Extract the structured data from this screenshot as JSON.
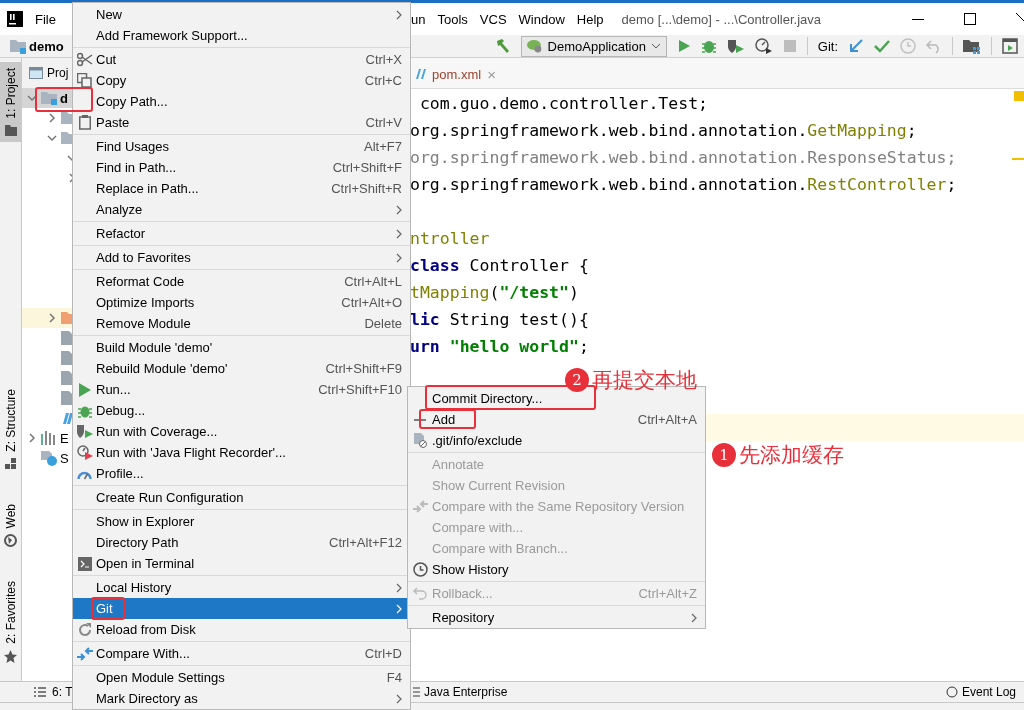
{
  "menu_bar": {
    "left_items": [
      "File"
    ],
    "right_items": [
      "un",
      "Tools",
      "VCS",
      "Window",
      "Help"
    ],
    "window_title": "demo [...\\demo] - ...\\Controller.java"
  },
  "nav_bar": {
    "project": "demo",
    "run_config": "DemoApplication",
    "git_label": "Git:"
  },
  "left_tool_tabs": [
    {
      "label": "1: Project",
      "selected": true
    },
    {
      "label": "Z: Structure",
      "selected": false
    },
    {
      "label": "Web",
      "selected": false
    },
    {
      "label": "2: Favorites",
      "selected": false
    }
  ],
  "project_panel": {
    "title": "Proj",
    "tree": [
      {
        "label": "d",
        "kind": "module",
        "selected": true,
        "expanded": true,
        "children": [
          {
            "kind": "folder",
            "selected": false,
            "expanded": false
          },
          {
            "kind": "folder",
            "selected": false,
            "expanded": true,
            "children": [
              {
                "selected": false,
                "expanded": true
              },
              {
                "selected": false,
                "expanded": false
              }
            ]
          },
          {
            "kind": "excluded-folder",
            "selected": false,
            "expanded": false
          },
          {
            "kind": "file",
            "selected": false
          },
          {
            "kind": "file",
            "selected": false
          },
          {
            "kind": "file",
            "selected": false
          },
          {
            "kind": "file",
            "selected": false
          },
          {
            "kind": "maven-file",
            "selected": false
          }
        ]
      },
      {
        "label": "E",
        "kind": "libraries",
        "selected": false,
        "expanded": false
      },
      {
        "label": "S",
        "kind": "scratches",
        "selected": false
      }
    ]
  },
  "editor": {
    "tab": {
      "label": "pom.xml",
      "close": "×"
    },
    "lines": [
      {
        "current": false,
        "tokens": [
          {
            "kind": "plain",
            "text": " com.guo.demo.controller.Test;"
          }
        ]
      },
      {
        "current": false,
        "tokens": [
          {
            "kind": "plain",
            "text": "org.springframework.web.bind.annotation."
          },
          {
            "kind": "annotation",
            "text": "GetMapping"
          },
          {
            "kind": "plain",
            "text": ";"
          }
        ]
      },
      {
        "current": false,
        "tokens": [
          {
            "kind": "unused",
            "text": "org.springframework.web.bind.annotation.ResponseStatus;"
          }
        ]
      },
      {
        "current": false,
        "tokens": [
          {
            "kind": "plain",
            "text": "org.springframework.web.bind.annotation."
          },
          {
            "kind": "annotation",
            "text": "RestController"
          },
          {
            "kind": "plain",
            "text": ";"
          }
        ]
      },
      {
        "current": false
      },
      {
        "current": false,
        "tokens": [
          {
            "kind": "annotation",
            "text": "ntroller"
          }
        ]
      },
      {
        "current": false,
        "tokens": [
          {
            "kind": "keyword",
            "text": "class"
          },
          {
            "kind": "plain",
            "text": " Controller {"
          }
        ]
      },
      {
        "current": false,
        "tokens": [
          {
            "kind": "annotation",
            "text": "tMapping"
          },
          {
            "kind": "plain",
            "text": "("
          },
          {
            "kind": "string",
            "text": "\"/test\""
          },
          {
            "kind": "plain",
            "text": ")"
          }
        ]
      },
      {
        "current": false,
        "tokens": [
          {
            "kind": "keyword",
            "text": "lic"
          },
          {
            "kind": "plain",
            "text": " String test(){"
          }
        ]
      },
      {
        "current": false,
        "tokens": [
          {
            "kind": "keyword",
            "text": "urn"
          },
          {
            "kind": "string",
            "text": " \"hello world\""
          },
          {
            "kind": "plain",
            "text": ";"
          }
        ]
      },
      {
        "current": false
      },
      {
        "current": false
      },
      {
        "current": true
      }
    ]
  },
  "context_menu": [
    {
      "kind": "item",
      "label": "New",
      "submenu": true,
      "selected": false
    },
    {
      "kind": "item",
      "label": "Add Framework Support...",
      "selected": false
    },
    {
      "kind": "separator"
    },
    {
      "kind": "item",
      "label": "Cut",
      "shortcut": "Ctrl+X",
      "selected": false
    },
    {
      "kind": "item",
      "label": "Copy",
      "shortcut": "Ctrl+C",
      "selected": false
    },
    {
      "kind": "item",
      "label": "Copy Path...",
      "selected": false
    },
    {
      "kind": "item",
      "label": "Paste",
      "shortcut": "Ctrl+V",
      "selected": false
    },
    {
      "kind": "separator"
    },
    {
      "kind": "item",
      "label": "Find Usages",
      "shortcut": "Alt+F7",
      "selected": false
    },
    {
      "kind": "item",
      "label": "Find in Path...",
      "shortcut": "Ctrl+Shift+F",
      "selected": false
    },
    {
      "kind": "item",
      "label": "Replace in Path...",
      "shortcut": "Ctrl+Shift+R",
      "selected": false
    },
    {
      "kind": "item",
      "label": "Analyze",
      "submenu": true,
      "selected": false
    },
    {
      "kind": "separator"
    },
    {
      "kind": "item",
      "label": "Refactor",
      "submenu": true,
      "selected": false
    },
    {
      "kind": "separator"
    },
    {
      "kind": "item",
      "label": "Add to Favorites",
      "submenu": true,
      "selected": false
    },
    {
      "kind": "separator"
    },
    {
      "kind": "item",
      "label": "Reformat Code",
      "shortcut": "Ctrl+Alt+L",
      "selected": false
    },
    {
      "kind": "item",
      "label": "Optimize Imports",
      "shortcut": "Ctrl+Alt+O",
      "selected": false
    },
    {
      "kind": "item",
      "label": "Remove Module",
      "shortcut": "Delete",
      "selected": false
    },
    {
      "kind": "separator"
    },
    {
      "kind": "item",
      "label": "Build Module 'demo'",
      "selected": false
    },
    {
      "kind": "item",
      "label": "Rebuild Module 'demo'",
      "shortcut": "Ctrl+Shift+F9",
      "selected": false
    },
    {
      "kind": "item",
      "label": "Run...",
      "shortcut": "Ctrl+Shift+F10",
      "selected": false
    },
    {
      "kind": "item",
      "label": "Debug...",
      "selected": false
    },
    {
      "kind": "item",
      "label": "Run with Coverage...",
      "selected": false
    },
    {
      "kind": "item",
      "label": "Run with 'Java Flight Recorder'...",
      "selected": false
    },
    {
      "kind": "item",
      "label": "Profile...",
      "selected": false
    },
    {
      "kind": "separator"
    },
    {
      "kind": "item",
      "label": "Create Run Configuration",
      "selected": false
    },
    {
      "kind": "separator"
    },
    {
      "kind": "item",
      "label": "Show in Explorer",
      "selected": false
    },
    {
      "kind": "item",
      "label": "Directory Path",
      "shortcut": "Ctrl+Alt+F12",
      "selected": false
    },
    {
      "kind": "item",
      "label": "Open in Terminal",
      "selected": false
    },
    {
      "kind": "separator"
    },
    {
      "kind": "item",
      "label": "Local History",
      "submenu": true,
      "selected": false
    },
    {
      "kind": "item",
      "label": "Git",
      "submenu": true,
      "selected": true
    },
    {
      "kind": "item",
      "label": "Reload from Disk",
      "selected": false
    },
    {
      "kind": "separator"
    },
    {
      "kind": "item",
      "label": "Compare With...",
      "shortcut": "Ctrl+D",
      "selected": false
    },
    {
      "kind": "separator"
    },
    {
      "kind": "item",
      "label": "Open Module Settings",
      "shortcut": "F4",
      "selected": false
    },
    {
      "kind": "item",
      "label": "Mark Directory as",
      "submenu": true,
      "selected": false
    }
  ],
  "git_submenu": [
    {
      "kind": "item",
      "label": "Commit Directory...",
      "disabled": false,
      "selected": false
    },
    {
      "kind": "item",
      "label": "Add",
      "shortcut": "Ctrl+Alt+A",
      "disabled": false,
      "selected": false
    },
    {
      "kind": "item",
      "label": ".git/info/exclude",
      "disabled": false,
      "selected": false
    },
    {
      "kind": "separator"
    },
    {
      "kind": "item",
      "label": "Annotate",
      "disabled": true,
      "selected": false
    },
    {
      "kind": "item",
      "label": "Show Current Revision",
      "disabled": true,
      "selected": false
    },
    {
      "kind": "item",
      "label": "Compare with the Same Repository Version",
      "disabled": true,
      "selected": false
    },
    {
      "kind": "item",
      "label": "Compare with...",
      "disabled": true,
      "selected": false
    },
    {
      "kind": "item",
      "label": "Compare with Branch...",
      "disabled": true,
      "selected": false
    },
    {
      "kind": "item",
      "label": "Show History",
      "disabled": false,
      "selected": false
    },
    {
      "kind": "separator"
    },
    {
      "kind": "item",
      "label": "Rollback...",
      "shortcut": "Ctrl+Alt+Z",
      "disabled": true,
      "selected": false
    },
    {
      "kind": "separator"
    },
    {
      "kind": "item",
      "label": "Repository",
      "submenu": true,
      "disabled": false,
      "selected": false
    }
  ],
  "annotations": [
    {
      "number": "2",
      "text": "再提交本地"
    },
    {
      "number": "1",
      "text": "先添加缓存"
    }
  ],
  "bottom_bar": {
    "left": "6: T",
    "middle": "Java Enterprise",
    "right": "Event Log"
  }
}
